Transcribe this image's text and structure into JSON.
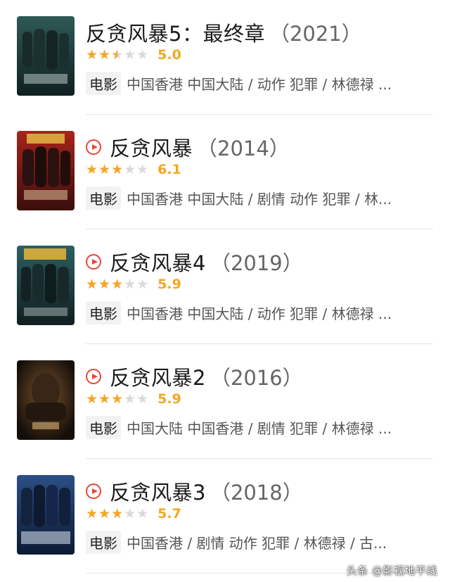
{
  "movies": [
    {
      "title": "反贪风暴5：最终章",
      "year": "（2021）",
      "has_play_icon": false,
      "stars_fraction": 0.5,
      "score": "5.0",
      "type_tag": "电影",
      "meta": "中国香港 中国大陆 / 动作 犯罪 / 林德禄 ..."
    },
    {
      "title": "反贪风暴",
      "year": "（2014）",
      "has_play_icon": true,
      "stars_fraction": 0.6,
      "score": "6.1",
      "type_tag": "电影",
      "meta": "中国香港 中国大陆 / 剧情 动作 犯罪 / 林..."
    },
    {
      "title": "反贪风暴4",
      "year": "（2019）",
      "has_play_icon": true,
      "stars_fraction": 0.6,
      "score": "5.9",
      "type_tag": "电影",
      "meta": "中国香港 中国大陆 / 动作 犯罪 / 林德禄 ..."
    },
    {
      "title": "反贪风暴2",
      "year": "（2016）",
      "has_play_icon": true,
      "stars_fraction": 0.6,
      "score": "5.9",
      "type_tag": "电影",
      "meta": "中国大陆 中国香港 / 剧情 犯罪 / 林德禄 ..."
    },
    {
      "title": "反贪风暴3",
      "year": "（2018）",
      "has_play_icon": true,
      "stars_fraction": 0.6,
      "score": "5.7",
      "type_tag": "电影",
      "meta": "中国香港 / 剧情 动作 犯罪 / 林德禄 / 古..."
    }
  ],
  "colors": {
    "star": "#f5a623",
    "play": "#e8463b"
  },
  "watermark": "头条 @影视地平线"
}
